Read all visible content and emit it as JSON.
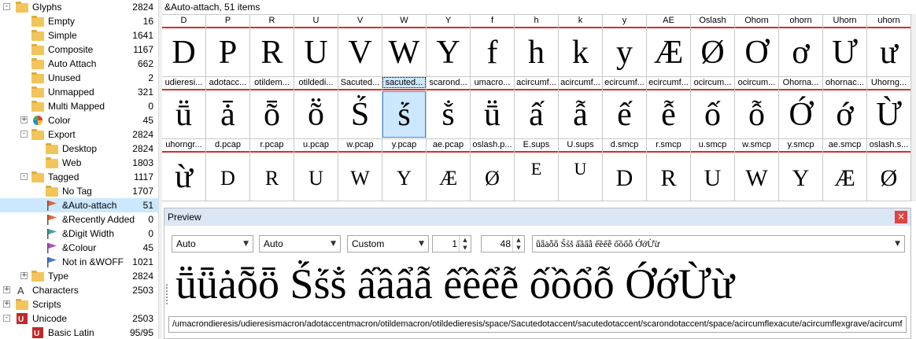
{
  "tree": [
    {
      "label": "Glyphs",
      "count": "2824",
      "level": 1,
      "exp": "-",
      "icon": "folder"
    },
    {
      "label": "Empty",
      "count": "16",
      "level": 2,
      "exp": "",
      "icon": "folder"
    },
    {
      "label": "Simple",
      "count": "1641",
      "level": 2,
      "exp": "",
      "icon": "folder"
    },
    {
      "label": "Composite",
      "count": "1167",
      "level": 2,
      "exp": "",
      "icon": "folder"
    },
    {
      "label": "Auto Attach",
      "count": "662",
      "level": 2,
      "exp": "",
      "icon": "folder"
    },
    {
      "label": "Unused",
      "count": "2",
      "level": 2,
      "exp": "",
      "icon": "folder"
    },
    {
      "label": "Unmapped",
      "count": "321",
      "level": 2,
      "exp": "",
      "icon": "folder"
    },
    {
      "label": "Multi Mapped",
      "count": "0",
      "level": 2,
      "exp": "",
      "icon": "folder"
    },
    {
      "label": "Color",
      "count": "45",
      "level": 2,
      "exp": "+",
      "icon": "color-wheel"
    },
    {
      "label": "Export",
      "count": "2824",
      "level": 2,
      "exp": "-",
      "icon": "folder"
    },
    {
      "label": "Desktop",
      "count": "2824",
      "level": 3,
      "exp": "",
      "icon": "folder"
    },
    {
      "label": "Web",
      "count": "1803",
      "level": 3,
      "exp": "",
      "icon": "folder"
    },
    {
      "label": "Tagged",
      "count": "1117",
      "level": 2,
      "exp": "-",
      "icon": "folder"
    },
    {
      "label": "No Tag",
      "count": "1707",
      "level": 3,
      "exp": "",
      "icon": "folder"
    },
    {
      "label": "&Auto-attach",
      "count": "51",
      "level": 3,
      "exp": "",
      "icon": "flag",
      "flag_color": "#e8622c",
      "selected": true
    },
    {
      "label": "&Recently Added",
      "count": "0",
      "level": 3,
      "exp": "",
      "icon": "flag",
      "flag_color": "#e8622c"
    },
    {
      "label": "&Digit Width",
      "count": "0",
      "level": 3,
      "exp": "",
      "icon": "flag",
      "flag_color": "#3aa89c"
    },
    {
      "label": "&Colour",
      "count": "45",
      "level": 3,
      "exp": "",
      "icon": "flag",
      "flag_color": "#b04cc4"
    },
    {
      "label": "Not in &WOFF",
      "count": "1021",
      "level": 3,
      "exp": "",
      "icon": "flag",
      "flag_color": "#3f7fd0"
    },
    {
      "label": "Type",
      "count": "2824",
      "level": 2,
      "exp": "+",
      "icon": "folder"
    },
    {
      "label": "Characters",
      "count": "2503",
      "level": 1,
      "exp": "+",
      "icon": "char-a"
    },
    {
      "label": "Scripts",
      "count": "",
      "level": 1,
      "exp": "+",
      "icon": "folder"
    },
    {
      "label": "Unicode",
      "count": "2503",
      "level": 1,
      "exp": "-",
      "icon": "unicode"
    },
    {
      "label": "Basic Latin",
      "count": "95/95",
      "level": 2,
      "exp": "",
      "icon": "unicode"
    }
  ],
  "grid": {
    "header": "&Auto-attach, 51 items",
    "rows": [
      [
        {
          "name": "D",
          "glyph": "D"
        },
        {
          "name": "P",
          "glyph": "P"
        },
        {
          "name": "R",
          "glyph": "R"
        },
        {
          "name": "U",
          "glyph": "U"
        },
        {
          "name": "V",
          "glyph": "V"
        },
        {
          "name": "W",
          "glyph": "W"
        },
        {
          "name": "Y",
          "glyph": "Y"
        },
        {
          "name": "f",
          "glyph": "f"
        },
        {
          "name": "h",
          "glyph": "h"
        },
        {
          "name": "k",
          "glyph": "k"
        },
        {
          "name": "y",
          "glyph": "y"
        },
        {
          "name": "AE",
          "glyph": "Æ"
        },
        {
          "name": "Oslash",
          "glyph": "Ø"
        },
        {
          "name": "Ohorn",
          "glyph": "Ơ"
        },
        {
          "name": "ohorn",
          "glyph": "ơ"
        },
        {
          "name": "Uhorn",
          "glyph": "Ư"
        },
        {
          "name": "uhorn",
          "glyph": "ư"
        }
      ],
      [
        {
          "name": "udieresi...",
          "glyph": "ṻ"
        },
        {
          "name": "adotacc...",
          "glyph": "ǡ"
        },
        {
          "name": "otildem...",
          "glyph": "ȭ"
        },
        {
          "name": "otildedi...",
          "glyph": "ṏ"
        },
        {
          "name": "Sacuted...",
          "glyph": "Ṥ"
        },
        {
          "name": "sacuted...",
          "glyph": "ṥ",
          "selected": true
        },
        {
          "name": "scarond...",
          "glyph": "ṧ"
        },
        {
          "name": "umacro...",
          "glyph": "ṻ"
        },
        {
          "name": "acircumf...",
          "glyph": "ấ"
        },
        {
          "name": "acircumf...",
          "glyph": "ẫ"
        },
        {
          "name": "ecircumf...",
          "glyph": "ế"
        },
        {
          "name": "ecircumf...",
          "glyph": "ễ"
        },
        {
          "name": "ocircum...",
          "glyph": "ố"
        },
        {
          "name": "ocircum...",
          "glyph": "ỗ"
        },
        {
          "name": "Ohorna...",
          "glyph": "Ớ"
        },
        {
          "name": "ohornac...",
          "glyph": "ớ"
        },
        {
          "name": "Uhorng...",
          "glyph": "Ừ"
        }
      ],
      [
        {
          "name": "uhorngr...",
          "glyph": "ừ"
        },
        {
          "name": "d.pcap",
          "glyph": "D",
          "small": true
        },
        {
          "name": "r.pcap",
          "glyph": "R",
          "small": true
        },
        {
          "name": "u.pcap",
          "glyph": "U",
          "small": true
        },
        {
          "name": "w.pcap",
          "glyph": "W",
          "small": true
        },
        {
          "name": "y.pcap",
          "glyph": "Y",
          "small": true
        },
        {
          "name": "ae.pcap",
          "glyph": "Æ",
          "small": true
        },
        {
          "name": "oslash.p...",
          "glyph": "Ø",
          "small": true
        },
        {
          "name": "E.sups",
          "glyph": "E",
          "sup": true
        },
        {
          "name": "U.sups",
          "glyph": "U",
          "sup": true
        },
        {
          "name": "d.smcp",
          "glyph": "D",
          "smcp": true
        },
        {
          "name": "r.smcp",
          "glyph": "R",
          "smcp": true
        },
        {
          "name": "u.smcp",
          "glyph": "U",
          "smcp": true
        },
        {
          "name": "w.smcp",
          "glyph": "W",
          "smcp": true
        },
        {
          "name": "y.smcp",
          "glyph": "Y",
          "smcp": true
        },
        {
          "name": "ae.smcp",
          "glyph": "Æ",
          "smcp": true
        },
        {
          "name": "oslash.s...",
          "glyph": "Ø",
          "smcp": true
        }
      ]
    ]
  },
  "preview": {
    "title": "Preview",
    "close": "×",
    "combo1": "Auto",
    "combo2": "Auto",
    "combo3": "Custom",
    "spin1": "1",
    "spin2": "48",
    "text_input": "ǖǟȧȭȫ Ṥṥṧ ấầẩẫ ếềểễ ốồổỗ ỚớỪừ",
    "rendered": "ṻǖȧȭȫ Ṥṥṧ ấầẩẫ ếềểễ ốồổỗ ỚớỪừ",
    "glyph_string": "/umacrondieresis/udieresismacron/adotaccentmacron/otildemacron/otildedieresis/space/Sacutedotaccent/sacutedotaccent/scarondotaccent/space/acircumflexacute/acircumflexgrave/acircumf"
  }
}
